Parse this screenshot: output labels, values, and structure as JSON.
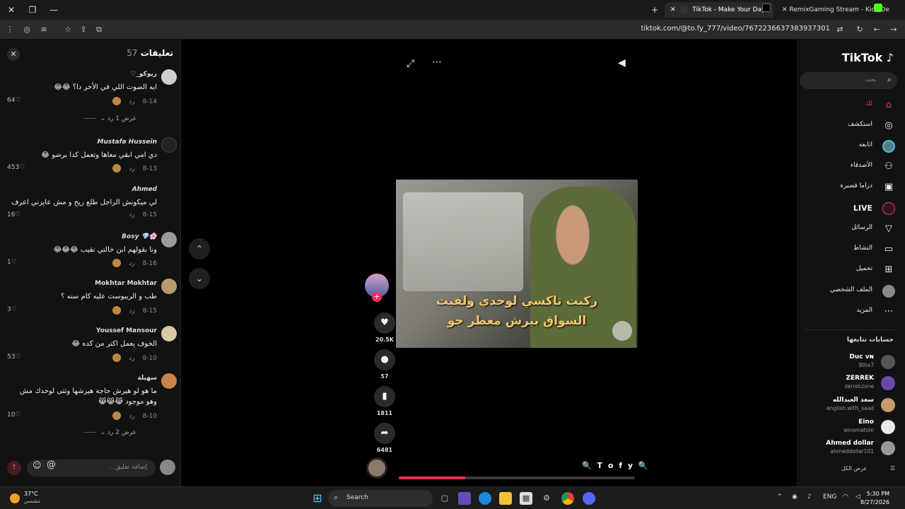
{
  "browser": {
    "tabs": [
      {
        "label": "TikTok - Make Your Day",
        "active": true
      },
      {
        "label": "RemixGaming Stream - Kick De",
        "active": false
      }
    ],
    "url": "tiktok.com/@to.fy_777/video/7672236637383937301"
  },
  "comments_panel": {
    "title": "تعليقات",
    "count": "57",
    "reply_label": "رد",
    "comments": [
      {
        "name": "ريوكو_♡",
        "text": "ايه الصوت اللي في الأخر دا؟ 😂😂",
        "date": "8-14",
        "likes": "64"
      },
      {
        "name": "Mustafa Hussein",
        "text": "دي امي ابقي معاها وتعمل كدا برضو 😂",
        "date": "8-13",
        "likes": "453"
      },
      {
        "name": "Ahmed",
        "text": "لي ميكونش الراجل طلع ريح و مش عايزني اعرف",
        "date": "8-15",
        "likes": "16"
      },
      {
        "name": "🌸💎 Bosy",
        "text": "ونا بقولهم ابن خالتي نقيب 😂😂😂",
        "date": "8-16",
        "likes": "1"
      },
      {
        "name": "Mokhtar Mokhtar",
        "text": "طب و الريبوست عليه كام سنه ؟",
        "date": "8-15",
        "likes": "3"
      },
      {
        "name": "Youssef Mansour",
        "text": "الخوف يعمل اكتر من كده 😂",
        "date": "8-10",
        "likes": "53"
      },
      {
        "name": "سهيلة",
        "text": "ما هو لو هيرش حاجة هيرشها وتتى لوحدك مش وهو موجود 😹😹😹",
        "date": "8-10",
        "likes": "10"
      }
    ],
    "view_replies_1": "عرض 1 رد",
    "view_replies_2": "عرض 2 رد",
    "input_placeholder": "إضافة تعليق..."
  },
  "video": {
    "caption_line1": "ركبت تاكسي لوحدي ولقيت",
    "caption_line2": "السواق بيرش معطر جو",
    "watermark": "🔍 T o f y 🔍",
    "progress": 0.28
  },
  "actions": {
    "likes": "20.5K",
    "comments": "57",
    "saves": "1811",
    "shares": "6481"
  },
  "sidebar": {
    "logo": "TikTok",
    "search_placeholder": "بحث",
    "nav": [
      {
        "label": "لك",
        "icon": "home-icon"
      },
      {
        "label": "استكشف",
        "icon": "compass-icon"
      },
      {
        "label": "اتابعه",
        "icon": "following-avatar-icon"
      },
      {
        "label": "الأصدقاء",
        "icon": "friends-icon"
      },
      {
        "label": "دراما قصيرة",
        "icon": "film-icon"
      },
      {
        "label": "LIVE",
        "icon": "live-icon"
      },
      {
        "label": "الرسائل",
        "icon": "send-icon"
      },
      {
        "label": "النشاط",
        "icon": "chat-icon"
      },
      {
        "label": "تحميل",
        "icon": "upload-icon"
      },
      {
        "label": "الملف الشخصي",
        "icon": "profile-icon"
      },
      {
        "label": "المزيد",
        "icon": "more-icon"
      }
    ],
    "following_header": "حسابات تتابعها",
    "accounts": [
      {
        "name": "Duc ᴠɴ",
        "handle": "9thx7"
      },
      {
        "name": "ZERREK",
        "handle": "zerrekzone"
      },
      {
        "name": "سعد العبدالله",
        "handle": "english.with_saad"
      },
      {
        "name": "Eino",
        "handle": "einomatoin"
      },
      {
        "name": "Ahmed dollar",
        "handle": "ahmeddollar101"
      }
    ],
    "see_all": "عرض الكل"
  },
  "taskbar": {
    "temperature": "37°C",
    "condition": "مشمس",
    "search_label": "Search",
    "lang": "ENG",
    "time": "5:30 PM",
    "date": "8/27/2026"
  },
  "colors": {
    "accent": "#fe2c55",
    "panel": "#121212",
    "background": "#000000"
  }
}
